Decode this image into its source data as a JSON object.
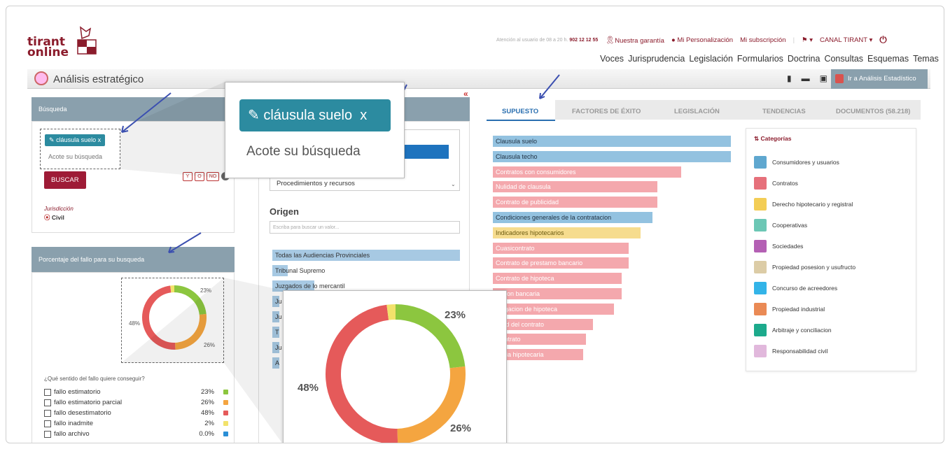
{
  "logo": {
    "line1": "tirant",
    "line2": "online"
  },
  "topbar": {
    "attention": "Atención al usuario de 08 a 20 h.",
    "phone": "902 12 12 55",
    "garantia": "Nuestra garantía",
    "personalizacion": "Mi Personalización",
    "suscripcion": "Mi subscripción",
    "canal": "CANAL TIRANT"
  },
  "nav": [
    "Voces",
    "Jurisprudencia",
    "Legislación",
    "Formularios",
    "Doctrina",
    "Consultas",
    "Esquemas",
    "Temas"
  ],
  "page": {
    "title": "Análisis estratégico",
    "ir_label": "Ir a Análisis Estadístico",
    "collapse": "«"
  },
  "search": {
    "header": "Búsqueda",
    "tag": "cláusula suelo",
    "tag_close": "x",
    "placeholder": "Acote su búsqueda",
    "button": "BUSCAR",
    "ops": [
      "Y",
      "O",
      "NO"
    ],
    "jurisdiccion_label": "Jurisdicción",
    "jurisdiccion_value": "Civil"
  },
  "zoom_search": {
    "tag": "cláusula suelo",
    "tag_close": "x",
    "placeholder": "Acote su búsqueda"
  },
  "filters": {
    "procedimientos": "Procedimientos y recursos",
    "origen_title": "Origen",
    "origen_placeholder": "Escriba para buscar un valor...",
    "origen_items": [
      "Todas las Audiencias Provinciales",
      "Tribunal Supremo",
      "Juzgados de lo mercantil",
      "Ju",
      "Ju",
      "T",
      "Ju",
      "A"
    ]
  },
  "fallo": {
    "header": "Porcentaje del fallo para su busqueda",
    "question": "¿Qué sentido del fallo quiere conseguir?",
    "items": [
      {
        "label": "fallo estimatorio",
        "pct": "23%",
        "color": "#8cc63f"
      },
      {
        "label": "fallo estimatorio parcial",
        "pct": "26%",
        "color": "#f4a540"
      },
      {
        "label": "fallo desestimatorio",
        "pct": "48%",
        "color": "#e55a5a"
      },
      {
        "label": "fallo inadmite",
        "pct": "2%",
        "color": "#f2e26b"
      },
      {
        "label": "fallo archivo",
        "pct": "0.0%",
        "color": "#2a8fd6"
      }
    ]
  },
  "tabs": [
    "SUPUESTO",
    "FACTORES DE ÉXITO",
    "LEGISLACIÓN",
    "TENDENCIAS",
    "DOCUMENTOS (58.218)"
  ],
  "supuesto": [
    {
      "label": "Clausula suelo",
      "value": 100,
      "color": "#93c2e0"
    },
    {
      "label": "Clausula techo",
      "value": 100,
      "color": "#93c2e0"
    },
    {
      "label": "Contratos con consumidores",
      "value": 79,
      "color": "#f4a8ad"
    },
    {
      "label": "Nulidad de clausula",
      "value": 69,
      "color": "#f4a8ad"
    },
    {
      "label": "Contrato de publicidad",
      "value": 69,
      "color": "#f4a8ad"
    },
    {
      "label": "Condiciones generales de la contratacion",
      "value": 67,
      "color": "#93c2e0"
    },
    {
      "label": "Indicadores hipotecarios",
      "value": 62,
      "color": "#f6dc8e"
    },
    {
      "label": "Cuasicontrato",
      "value": 57,
      "color": "#f4a8ad"
    },
    {
      "label": "Contrato de prestamo bancario",
      "value": 57,
      "color": "#f4a8ad"
    },
    {
      "label": "Contrato de hipoteca",
      "value": 54,
      "color": "#f4a8ad"
    },
    {
      "label": "...ision bancaria",
      "value": 54,
      "color": "#f4a8ad"
    },
    {
      "label": "...ogacion de hipoteca",
      "value": 51,
      "color": "#f4a8ad"
    },
    {
      "label": "...lad del contrato",
      "value": 42,
      "color": "#f4a8ad"
    },
    {
      "label": "...ontrato",
      "value": 39,
      "color": "#f4a8ad"
    },
    {
      "label": "...ntia hipotecaria",
      "value": 38,
      "color": "#f4a8ad"
    }
  ],
  "categorias": {
    "title": "Categorías",
    "items": [
      {
        "label": "Consumidores y usuarios",
        "color": "#5fa7cf"
      },
      {
        "label": "Contratos",
        "color": "#e6707b"
      },
      {
        "label": "Derecho hipotecario y registral",
        "color": "#f3cd55"
      },
      {
        "label": "Cooperativas",
        "color": "#6cc7b5"
      },
      {
        "label": "Sociedades",
        "color": "#b460b4"
      },
      {
        "label": "Propiedad posesion y usufructo",
        "color": "#dccca6"
      },
      {
        "label": "Concurso de acreedores",
        "color": "#33b4e8"
      },
      {
        "label": "Propiedad industrial",
        "color": "#ea8a55"
      },
      {
        "label": "Arbitraje y conciliacion",
        "color": "#1daa8c"
      },
      {
        "label": "Responsabilidad civil",
        "color": "#e1b8dc"
      }
    ]
  },
  "chart_data": {
    "type": "pie",
    "categories": [
      "fallo estimatorio",
      "fallo estimatorio parcial",
      "fallo desestimatorio",
      "fallo inadmite",
      "fallo archivo"
    ],
    "values": [
      23,
      26,
      48,
      2,
      0
    ],
    "data_labels": [
      "23%",
      "26%",
      "48%"
    ]
  }
}
